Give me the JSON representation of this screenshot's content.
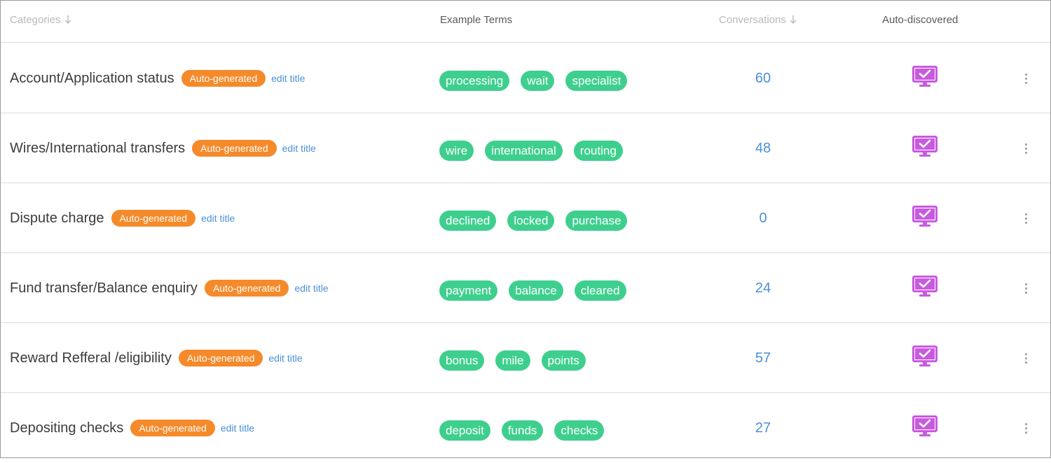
{
  "header": {
    "categories": "Categories",
    "example_terms": "Example Terms",
    "conversations": "Conversations",
    "auto_discovered": "Auto-discovered"
  },
  "colors": {
    "badge": "#f58a2b",
    "chip": "#3ecf8e",
    "link": "#4a90d9",
    "monitor_icon": "#c85ae0"
  },
  "icons": {
    "sort": "arrow-down-icon",
    "auto_discovered": "monitor-check-icon",
    "menu": "kebab-menu-icon"
  },
  "rows": [
    {
      "title": "Account/Application status",
      "badge": "Auto-generated",
      "edit": "edit title",
      "terms": [
        "processing",
        "wait",
        "specialist"
      ],
      "conversations": "60"
    },
    {
      "title": "Wires/International transfers",
      "badge": "Auto-generated",
      "edit": "edit title",
      "terms": [
        "wire",
        "international",
        "routing"
      ],
      "conversations": "48"
    },
    {
      "title": "Dispute charge",
      "badge": "Auto-generated",
      "edit": "edit title",
      "terms": [
        "declined",
        "locked",
        "purchase"
      ],
      "conversations": "0"
    },
    {
      "title": "Fund transfer/Balance enquiry",
      "badge": "Auto-generated",
      "edit": "edit title",
      "terms": [
        "payment",
        "balance",
        "cleared"
      ],
      "conversations": "24"
    },
    {
      "title": "Reward Refferal /eligibility",
      "badge": "Auto-generated",
      "edit": "edit title",
      "terms": [
        "bonus",
        "mile",
        "points"
      ],
      "conversations": "57"
    },
    {
      "title": "Depositing checks",
      "badge": "Auto-generated",
      "edit": "edit title",
      "terms": [
        "deposit",
        "funds",
        "checks"
      ],
      "conversations": "27"
    }
  ]
}
